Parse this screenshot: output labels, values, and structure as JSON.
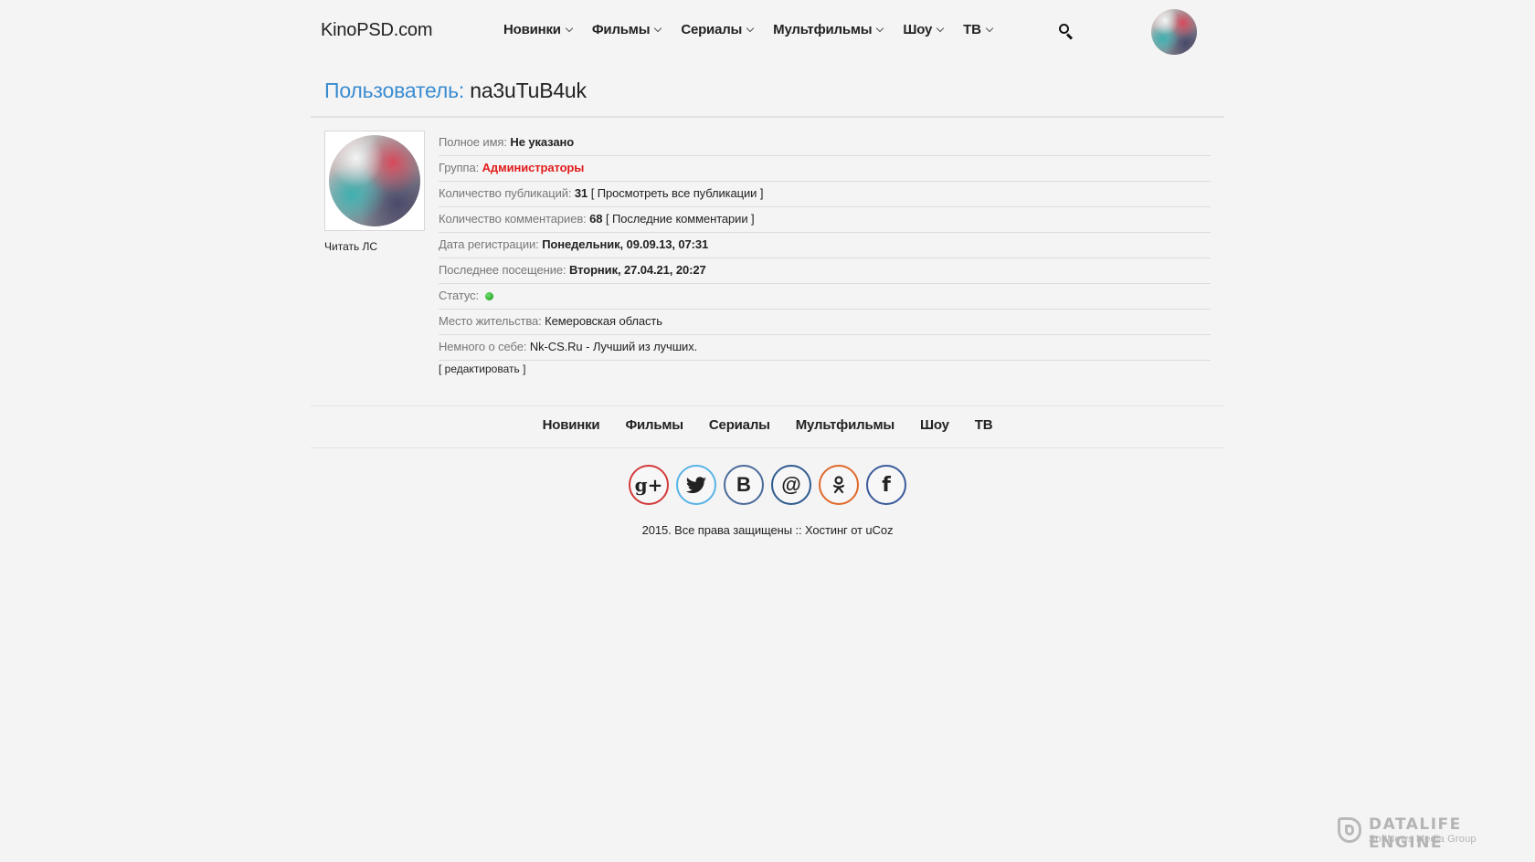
{
  "header": {
    "logo": "KinoPSD.com",
    "nav": [
      {
        "label": "Новинки"
      },
      {
        "label": "Фильмы"
      },
      {
        "label": "Сериалы"
      },
      {
        "label": "Мультфильмы"
      },
      {
        "label": "Шоу"
      },
      {
        "label": "ТВ"
      }
    ],
    "search_icon": "search-icon",
    "avatar_icon": "user-avatar"
  },
  "profile": {
    "title_label": "Пользователь:",
    "username": "na3uTuB4uk",
    "read_pm": "Читать ЛС",
    "full_name": {
      "label": "Полное имя:",
      "value": "Не указано"
    },
    "group": {
      "label": "Группа:",
      "value": "Администраторы"
    },
    "publications": {
      "label": "Количество публикаций:",
      "value": "31",
      "link": "[ Просмотреть все публикации ]"
    },
    "comments": {
      "label": "Количество комментариев:",
      "value": "68",
      "link": "[ Последние комментарии ]"
    },
    "registered": {
      "label": "Дата регистрации:",
      "value": "Понедельник, 09.09.13, 07:31"
    },
    "last_visit": {
      "label": "Последнее посещение:",
      "value": "Вторник, 27.04.21, 20:27"
    },
    "status": {
      "label": "Статус:",
      "value_icon": "online-status-icon"
    },
    "location": {
      "label": "Место жительства:",
      "value": "Кемеровская область"
    },
    "about": {
      "label": "Немного о себе:",
      "value": "Nk-CS.Ru - Лучший из лучших."
    },
    "edit_link": "[ редактировать ]"
  },
  "footer": {
    "nav": [
      {
        "label": "Новинки"
      },
      {
        "label": "Фильмы"
      },
      {
        "label": "Сериалы"
      },
      {
        "label": "Мультфильмы"
      },
      {
        "label": "Шоу"
      },
      {
        "label": "ТВ"
      }
    ],
    "social": [
      {
        "icon": "google-plus-icon",
        "glyph": "g+",
        "color": "#d23a3a"
      },
      {
        "icon": "twitter-icon",
        "glyph": "",
        "color": "#58b3e6"
      },
      {
        "icon": "vk-icon",
        "glyph": "B",
        "color": "#4a6a9a"
      },
      {
        "icon": "mail-ru-icon",
        "glyph": "@",
        "color": "#2e5a8f"
      },
      {
        "icon": "odnoklassniki-icon",
        "glyph": "",
        "color": "#e0692a"
      },
      {
        "icon": "facebook-icon",
        "glyph": "f",
        "color": "#3a5a9a"
      }
    ],
    "copyright_text": "2015. Все права защищены :: ",
    "hosting_link": "Хостинг от uCoz"
  },
  "watermark": {
    "title": "DATALIFE ENGINE",
    "subtitle": "SoftNews Media Group"
  },
  "colors": {
    "accent": "#3a8cd0",
    "admin_group": "#e21c1c",
    "online": "#139013",
    "background": "#f4f4f4"
  }
}
